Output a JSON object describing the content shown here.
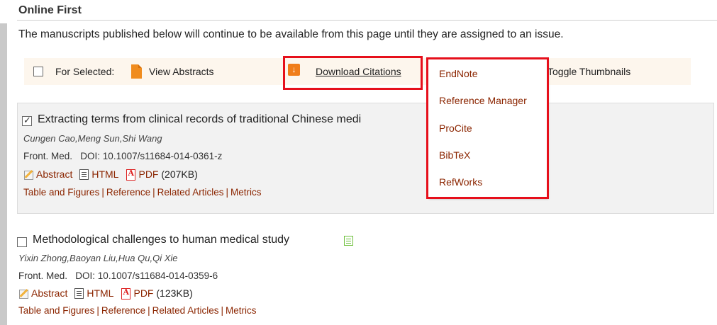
{
  "section": {
    "title": "Online First",
    "intro": "The manuscripts published below will continue to be available from this page until they are assigned to an issue."
  },
  "toolbar": {
    "for_selected_label": "For Selected:",
    "view_abstracts_label": "View Abstracts",
    "download_citations_label": "Download Citations",
    "toggle_thumbnails_label": "Toggle Thumbnails"
  },
  "dropdown": {
    "items": [
      "EndNote",
      "Reference Manager",
      "ProCite",
      "BibTeX",
      "RefWorks"
    ]
  },
  "articles": [
    {
      "title": "Extracting terms from clinical records of traditional Chinese medi",
      "authors": "Cungen Cao,Meng Sun,Shi Wang",
      "journal": "Front. Med.",
      "doi": "DOI: 10.1007/s11684-014-0361-z",
      "abstract_label": "Abstract",
      "html_label": "HTML",
      "pdf_label": "PDF",
      "pdf_size": "(207KB)",
      "tabs": [
        "Table and Figures",
        "Reference",
        "Related Articles",
        "Metrics"
      ],
      "checked": true
    },
    {
      "title": "Methodological challenges to human medical study",
      "authors": "Yixin Zhong,Baoyan Liu,Hua Qu,Qi Xie",
      "journal": "Front. Med.",
      "doi": "DOI: 10.1007/s11684-014-0359-6",
      "abstract_label": "Abstract",
      "html_label": "HTML",
      "pdf_label": "PDF",
      "pdf_size": "(123KB)",
      "tabs": [
        "Table and Figures",
        "Reference",
        "Related Articles",
        "Metrics"
      ],
      "checked": false
    }
  ],
  "colors": {
    "link": "#8b2500",
    "highlight_box": "#e60f1b",
    "toolbar_bg": "#fdf6ed",
    "icon_orange": "#f07d1a"
  },
  "icons": {
    "view_abstracts": "orange-document-icon",
    "download": "download-arrow-icon",
    "abstract": "pencil-icon",
    "html": "html-page-icon",
    "pdf": "pdf-icon",
    "fulltext": "green-list-icon"
  }
}
